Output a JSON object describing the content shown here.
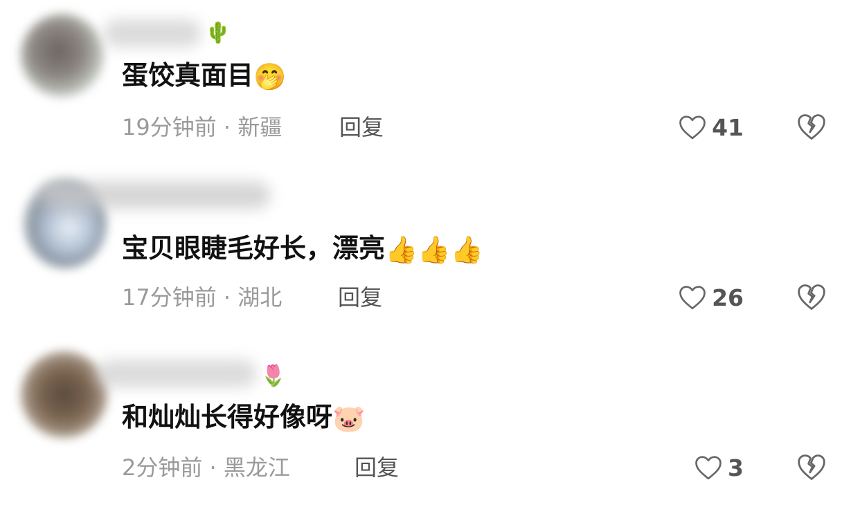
{
  "comments": [
    {
      "name_emoji": "🌵",
      "text": "蛋饺真面目",
      "text_emoji": "🤭",
      "time": "19分钟前",
      "location": "新疆",
      "reply_label": "回复",
      "likes": "41"
    },
    {
      "name_emoji": "",
      "text": "宝贝眼睫毛好长，漂亮",
      "text_emoji": "👍👍👍",
      "time": "17分钟前",
      "location": "湖北",
      "reply_label": "回复",
      "likes": "26"
    },
    {
      "name_emoji": "🌷",
      "text": "和灿灿长得好像呀",
      "text_emoji": "🐷",
      "time": "2分钟前",
      "location": "黑龙江",
      "reply_label": "回复",
      "likes": "3"
    }
  ],
  "separator": " · ",
  "icons": {
    "like": "heart-outline-icon",
    "dislike": "broken-heart-icon"
  },
  "colors": {
    "text": "#111111",
    "meta": "#9a9a9a",
    "action": "#555555"
  }
}
